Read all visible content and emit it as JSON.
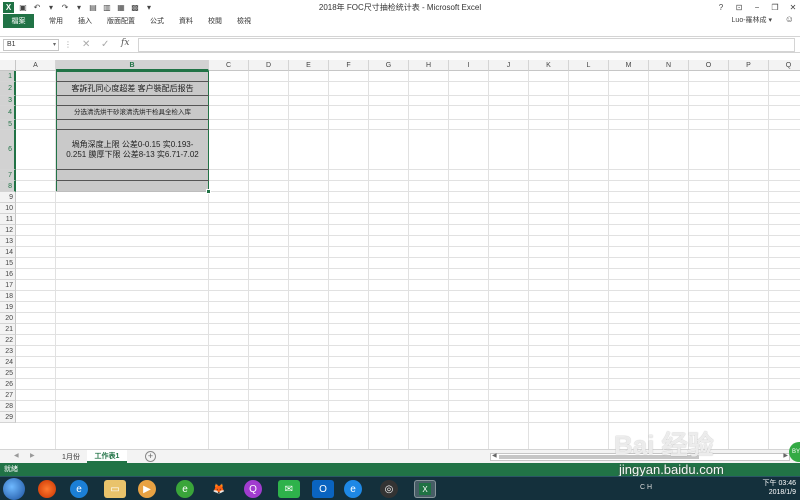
{
  "window": {
    "title": "2018年 FOC尺寸抽检统计表 - Microsoft Excel",
    "help": "?",
    "minimize": "−",
    "restore": "❐",
    "close": "✕"
  },
  "ribbon": {
    "file_tab": "檔案",
    "tabs": [
      "常用",
      "插入",
      "版面配置",
      "公式",
      "資料",
      "校閱",
      "檢視"
    ],
    "user": "Luo-羅林成 ▾"
  },
  "formula_bar": {
    "name_box": "B1",
    "fx": "fx",
    "value": ""
  },
  "sheet": {
    "columns": [
      "A",
      "B",
      "C",
      "D",
      "E",
      "F",
      "G",
      "H",
      "I",
      "J",
      "K",
      "L",
      "M",
      "N",
      "O",
      "P",
      "Q"
    ],
    "rows": [
      "1",
      "2",
      "3",
      "4",
      "5",
      "6",
      "7",
      "8",
      "9",
      "10",
      "11",
      "12",
      "13",
      "14",
      "15",
      "16",
      "17",
      "18",
      "19",
      "20",
      "21",
      "22",
      "23",
      "24",
      "25",
      "26",
      "27",
      "28",
      "29"
    ],
    "selected_column": "B",
    "cells": {
      "B2": "客訴孔同心度超差 客户裝配后报告",
      "B4": "分选清洗烘干砂滚清洗烘干检具全检入库",
      "B6": "堝角深度上限 公差0-0.15  实0.193-0.251 膜厚下限 公差8-13  实6.71-7.02"
    }
  },
  "sheet_tabs": [
    "1月份",
    "工作表1"
  ],
  "active_sheet": "工作表1",
  "status": {
    "text": "就緒"
  },
  "taskbar": {
    "time": "下午 03:46",
    "date": "2018/1/9",
    "ime": "CH"
  },
  "watermark": {
    "logo": "Bai 经验",
    "url": "jingyan.baidu.com"
  }
}
